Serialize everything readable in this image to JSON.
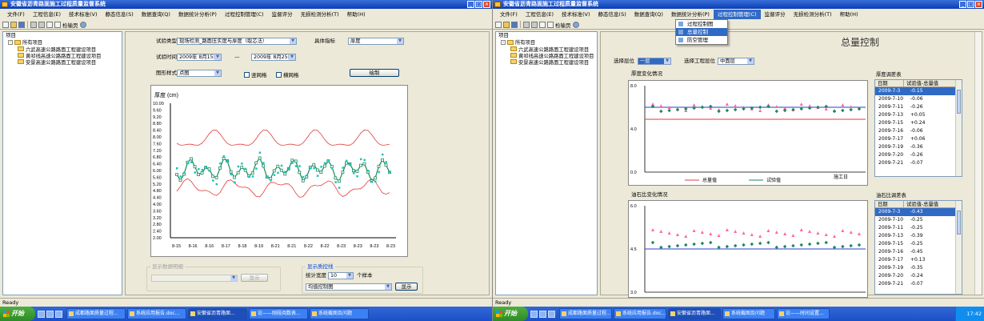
{
  "app": {
    "title": "安徽省沥青路面施工过程质量监督系统",
    "menu": [
      "文件(F)",
      "工程信息(E)",
      "技术标准(V)",
      "静态信息(S)",
      "数据查询(Q)",
      "数据统计分析(P)",
      "过程控制管理(C)",
      "监督评分",
      "无损检测分析(T)",
      "帮助(H)"
    ],
    "toolbar_label": "检输页",
    "status": "Ready"
  },
  "tree": {
    "header": "项目",
    "root": "所有项目",
    "children": [
      "六武高速公路路面工程建设项目",
      "黄祁线高速公路路面工程建设项目",
      "安景高速公路路面工程建设项目"
    ]
  },
  "left": {
    "test_type_label": "试验类型",
    "test_type_value": "现场检测_路面压实度与厚度（取芯法）",
    "indicator_label": "具体指标",
    "indicator_value": "厚度",
    "time_label": "试验时间",
    "date_from": "2009年 8月15日",
    "date_sep": "—",
    "date_to": "2009年 8月25日",
    "style_label": "图形样式",
    "style_value": "点图",
    "vgrid_label": "竖网格",
    "hgrid_label": "横网格",
    "draw_button": "绘制",
    "detail_group_title": "显示数据明细",
    "detail_button": "显示",
    "control_group_title": "显示质控线",
    "stat_width_label": "统计宽度",
    "stat_width_value": "10",
    "sample_unit": "个样本",
    "chart_type_value": "均值控制图",
    "show_button": "显示"
  },
  "left_chart": {
    "ylabel": "厚度 (cm)",
    "yticks": [
      "10.00",
      "9.60",
      "9.20",
      "8.80",
      "8.40",
      "8.00",
      "7.60",
      "7.20",
      "6.80",
      "6.40",
      "6.00",
      "5.60",
      "5.20",
      "4.80",
      "4.40",
      "4.00",
      "3.60",
      "3.20",
      "2.80",
      "2.40",
      "2.00"
    ],
    "xticks": [
      "8-15",
      "8-16",
      "8-16",
      "8-17",
      "8-18",
      "8-19",
      "8-21",
      "8-21",
      "8-22",
      "8-22",
      "8-23",
      "8-23",
      "8-23",
      "8-23"
    ]
  },
  "right": {
    "title": "总量控制",
    "dropdown": [
      "过程控制图",
      "总量控制",
      "防空管理"
    ],
    "layer_label": "选择层位",
    "layer_value": "一层",
    "struct_label": "选择工程层位",
    "struct_value": "中面层",
    "top_chart_title": "厚度变化情况",
    "top_legend": [
      "总量值",
      "试验值",
      "施工日"
    ],
    "top_yticks": [
      "8.0",
      "4.0",
      "0.0"
    ],
    "top_table_title": "厚度调差表",
    "bottom_chart_title": "油石比变化情况",
    "bottom_yticks": [
      "6.0",
      "4.5",
      "3.0"
    ],
    "bottom_table_title": "油石比调差表",
    "table_headers": [
      "日期",
      "试验值-总量值"
    ],
    "top_rows": [
      [
        "2009-7-3",
        "-0.15"
      ],
      [
        "2009-7-10",
        "-0.06"
      ],
      [
        "2009-7-11",
        "-0.26"
      ],
      [
        "2009-7-13",
        "+0.05"
      ],
      [
        "2009-7-15",
        "+0.24"
      ],
      [
        "2009-7-16",
        "-0.06"
      ],
      [
        "2009-7-17",
        "+0.06"
      ],
      [
        "2009-7-19",
        "-0.36"
      ],
      [
        "2009-7-20",
        "-0.26"
      ],
      [
        "2009-7-21",
        "-0.07"
      ]
    ],
    "bottom_rows": [
      [
        "2009-7-3",
        "-0.43"
      ],
      [
        "2009-7-10",
        "-0.25"
      ],
      [
        "2009-7-11",
        "-0.25"
      ],
      [
        "2009-7-13",
        "-0.39"
      ],
      [
        "2009-7-15",
        "-0.25"
      ],
      [
        "2009-7-16",
        "-0.45"
      ],
      [
        "2009-7-17",
        "+0.13"
      ],
      [
        "2009-7-19",
        "-0.35"
      ],
      [
        "2009-7-20",
        "-0.24"
      ],
      [
        "2009-7-21",
        "-0.07"
      ]
    ]
  },
  "taskbar": {
    "start": "开始",
    "left_tasks": [
      "成都路面质量过程...",
      "系统应用报告.doc...",
      "安徽省沥青路面...",
      "论——刚段阅数表...",
      "系统截图及问题"
    ],
    "right_tasks": [
      "成都路面质量过程...",
      "系统应用报告.doc...",
      "安徽省沥青路面...",
      "系统截图及问题",
      "论——时间设置..."
    ],
    "clock": "17:42"
  },
  "colors": {
    "title_blue": "#0a3fb8",
    "series_green": "#1a8a5a",
    "series_cyan": "#19c2c2",
    "limit_red": "#e23b3b",
    "marker_pink": "#ff66aa"
  }
}
